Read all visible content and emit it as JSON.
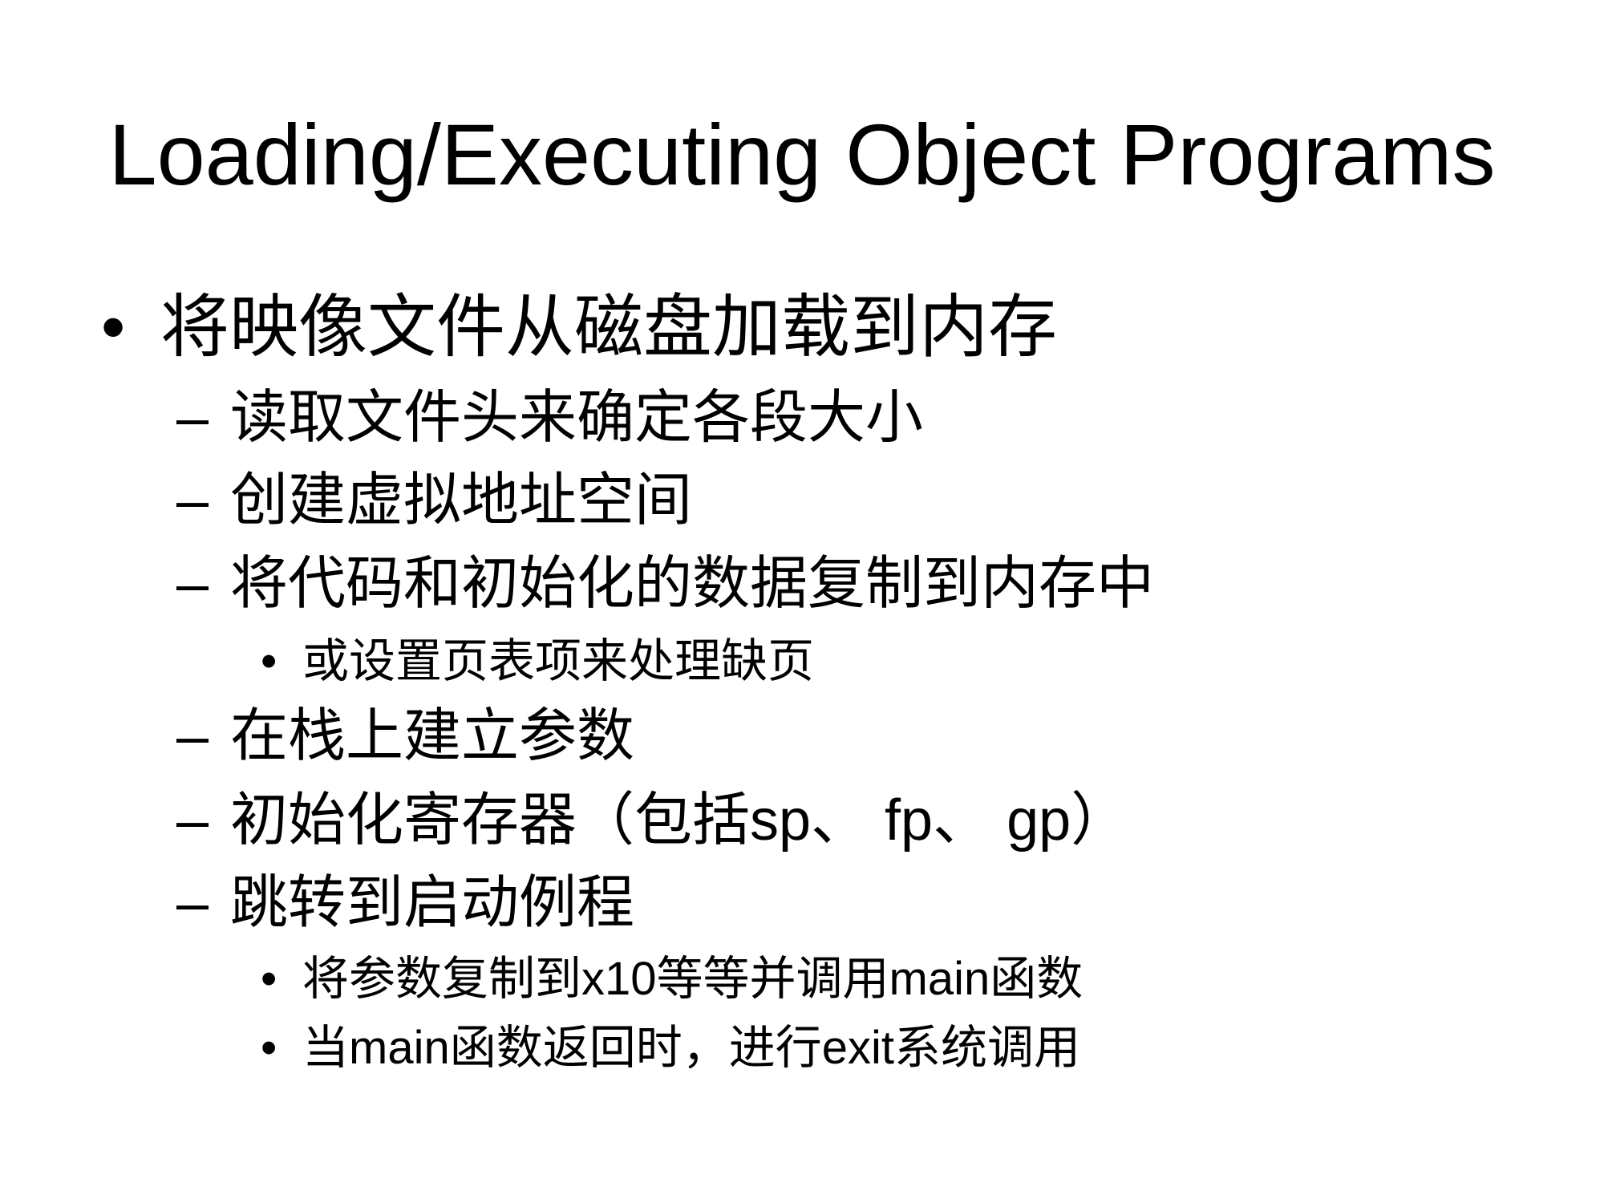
{
  "slide": {
    "title": "Loading/Executing Object Programs",
    "bullet_l1": "•",
    "bullet_l2": "–",
    "bullet_l3": "•",
    "items": [
      {
        "level": 1,
        "text": "将映像文件从磁盘加载到内存"
      },
      {
        "level": 2,
        "text": "读取文件头来确定各段大小"
      },
      {
        "level": 2,
        "text": "创建虚拟地址空间"
      },
      {
        "level": 2,
        "text": "将代码和初始化的数据复制到内存中"
      },
      {
        "level": 3,
        "text": "或设置页表项来处理缺页"
      },
      {
        "level": 2,
        "text": "在栈上建立参数"
      },
      {
        "level": 2,
        "text": "初始化寄存器（包括sp、 fp、 gp）"
      },
      {
        "level": 2,
        "text": "跳转到启动例程"
      },
      {
        "level": 3,
        "text": "将参数复制到x10等等并调用main函数"
      },
      {
        "level": 3,
        "text": "当main函数返回时，进行exit系统调用"
      }
    ]
  }
}
